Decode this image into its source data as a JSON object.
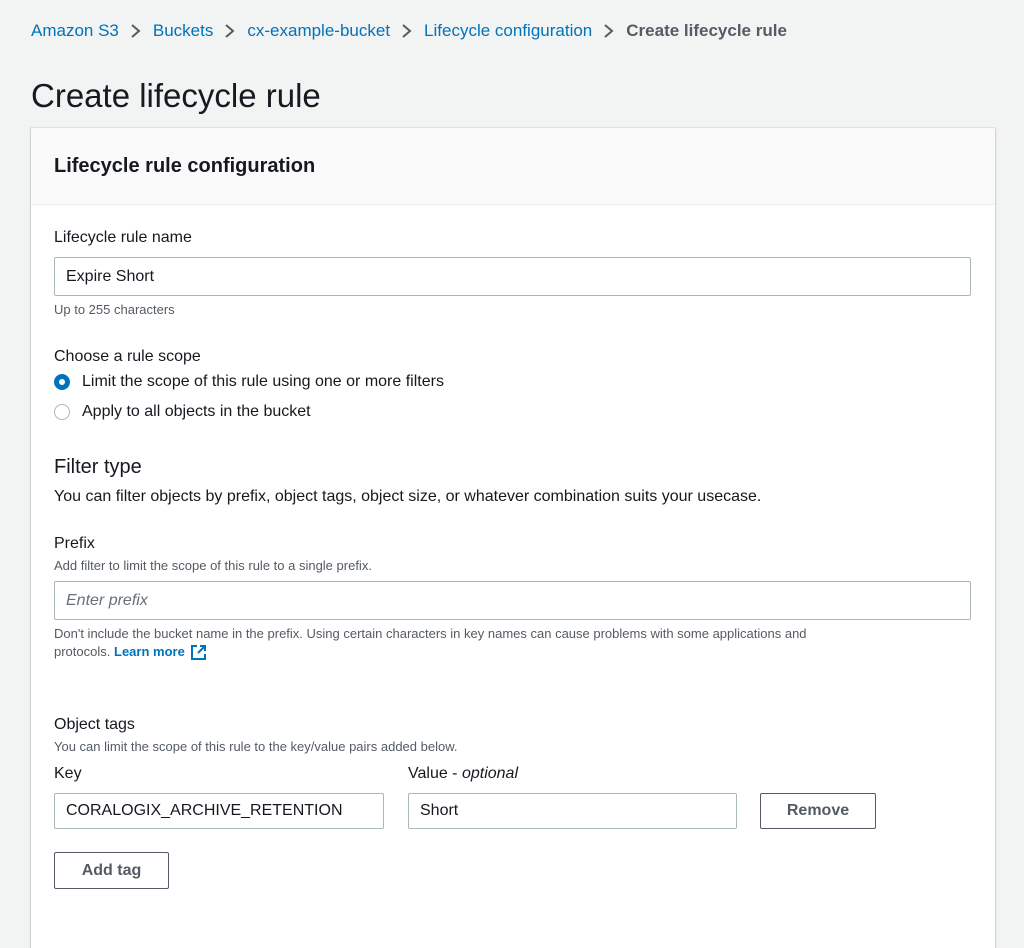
{
  "breadcrumb": {
    "items": [
      "Amazon S3",
      "Buckets",
      "cx-example-bucket",
      "Lifecycle configuration"
    ],
    "current": "Create lifecycle rule"
  },
  "page": {
    "title": "Create lifecycle rule"
  },
  "panel": {
    "title": "Lifecycle rule configuration"
  },
  "rule_name": {
    "label": "Lifecycle rule name",
    "value": "Expire Short",
    "hint": "Up to 255 characters"
  },
  "scope": {
    "label": "Choose a rule scope",
    "options": [
      {
        "label": "Limit the scope of this rule using one or more filters",
        "checked": true
      },
      {
        "label": "Apply to all objects in the bucket",
        "checked": false
      }
    ]
  },
  "filter_type": {
    "title": "Filter type",
    "description": "You can filter objects by prefix, object tags, object size, or whatever combination suits your usecase."
  },
  "prefix": {
    "label": "Prefix",
    "description": "Add filter to limit the scope of this rule to a single prefix.",
    "placeholder": "Enter prefix",
    "value": "",
    "hint_line1": "Don't include the bucket name in the prefix. Using certain characters in key names can cause problems with some applications and",
    "hint_line2": "protocols.",
    "learn_more": "Learn more"
  },
  "object_tags": {
    "label": "Object tags",
    "description": "You can limit the scope of this rule to the key/value pairs added below.",
    "key_label": "Key",
    "value_label": "Value - ",
    "value_optional": "optional",
    "tags": [
      {
        "key": "CORALOGIX_ARCHIVE_RETENTION",
        "value": "Short"
      }
    ],
    "remove_label": "Remove",
    "add_tag_label": "Add tag"
  },
  "colors": {
    "link": "#0073bb",
    "text": "#16191f",
    "secondary_text": "#545b64",
    "border": "#aab7b8",
    "background": "#f2f3f3"
  }
}
